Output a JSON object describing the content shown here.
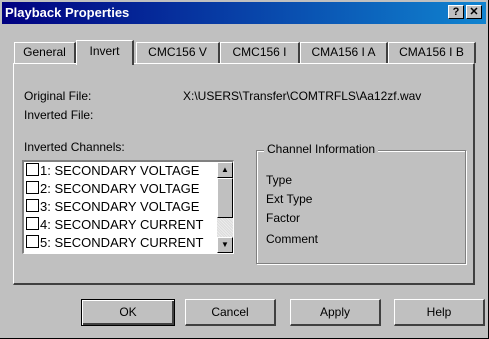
{
  "window": {
    "title": "Playback Properties",
    "help_label": "?",
    "close_label": "x"
  },
  "tabs": [
    {
      "label": "General",
      "active": false
    },
    {
      "label": "Invert",
      "active": true
    },
    {
      "label": "CMC156 V",
      "active": false
    },
    {
      "label": "CMC156 I",
      "active": false
    },
    {
      "label": "CMA156 I A",
      "active": false
    },
    {
      "label": "CMA156 I B",
      "active": false
    }
  ],
  "invert": {
    "original_file_label": "Original File:",
    "original_file_value": "X:\\USERS\\Transfer\\COMTRFLS\\Aa12zf.wav",
    "inverted_file_label": "Inverted File:",
    "inverted_channels_label": "Inverted Channels:",
    "channels": [
      {
        "label": "1: SECONDARY VOLTAGE",
        "checked": false
      },
      {
        "label": "2: SECONDARY VOLTAGE",
        "checked": false
      },
      {
        "label": "3: SECONDARY VOLTAGE",
        "checked": false
      },
      {
        "label": "4: SECONDARY CURRENT",
        "checked": false
      },
      {
        "label": "5: SECONDARY CURRENT",
        "checked": false
      }
    ],
    "channel_info": {
      "title": "Channel Information",
      "fields": [
        "Type",
        "Ext Type",
        "Factor",
        "Comment"
      ]
    }
  },
  "buttons": {
    "ok": "OK",
    "cancel": "Cancel",
    "apply": "Apply",
    "help": "Help"
  }
}
